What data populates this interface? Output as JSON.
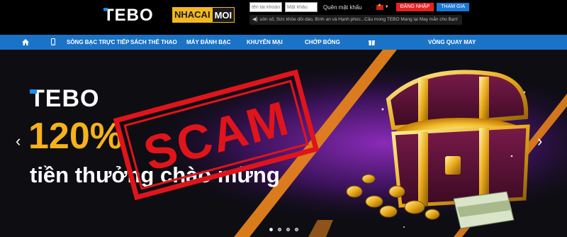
{
  "header": {
    "logo": "TEBO",
    "partner_logo": {
      "part1": "NHACAI",
      "part2": "MOI"
    },
    "username_placeholder": "tên tài khoản",
    "password_placeholder": "Mật khẩu",
    "forgot_password": "Quên mật khẩu",
    "register_button": "ĐĂNG NHẬP",
    "join_button": "THAM GIA",
    "marquee_text": "uôn số, Sức khỏe dồi dào, Bình an và Hạnh phúc...Cầu mong TEBO Mang lại May mắn cho Bạn!"
  },
  "nav": {
    "items": [
      {
        "label": "SÒNG BẠC TRỰC TIẾP"
      },
      {
        "label": "SÁCH THỂ THAO"
      },
      {
        "label": "MÁY ĐÁNH BẠC"
      },
      {
        "label": "KHUYẾN MẠI"
      },
      {
        "label": "CHỚP BÓNG"
      },
      {
        "label": "VÒNG QUAY MAY"
      }
    ],
    "icons": [
      "home-icon",
      "mobile-icon",
      "gift-icon"
    ]
  },
  "banner": {
    "brand": "TEBO",
    "headline": "120%",
    "subline": "tiền thưởng chào mừng",
    "stamp_text": "SCAM",
    "slide_count": 4,
    "active_slide": 1
  },
  "colors": {
    "nav": "#1a73c6",
    "accent_gold": "#f6b11c",
    "stamp_red": "#e0141b",
    "register_red": "#e82125",
    "join_blue": "#1b78d6"
  }
}
